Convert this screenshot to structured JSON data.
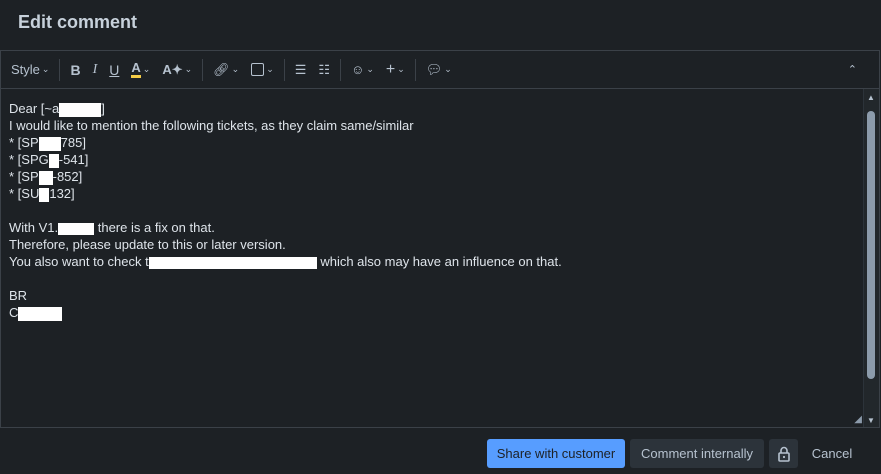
{
  "dialog": {
    "title": "Edit comment"
  },
  "toolbar": {
    "style_label": "Style"
  },
  "content": {
    "lines": [
      "Dear [~a",
      "I would like to mention the following tickets, as they claim same/similar",
      "* [SP",
      "785]",
      "* [SPG",
      "-541]",
      "* [SP",
      "-852]",
      "* [SU",
      "132]",
      "With V1.",
      " there is a fix on that.",
      "Therefore, please update to this or later version.",
      "You also want to check t",
      " which also may have an influence on that.",
      "BR",
      "C",
      "]"
    ]
  },
  "footer": {
    "share_label": "Share with customer",
    "internal_label": "Comment internally",
    "cancel_label": "Cancel"
  },
  "colors": {
    "accent": "#579dff",
    "background": "#1d2125",
    "text": "#dee4ea"
  }
}
